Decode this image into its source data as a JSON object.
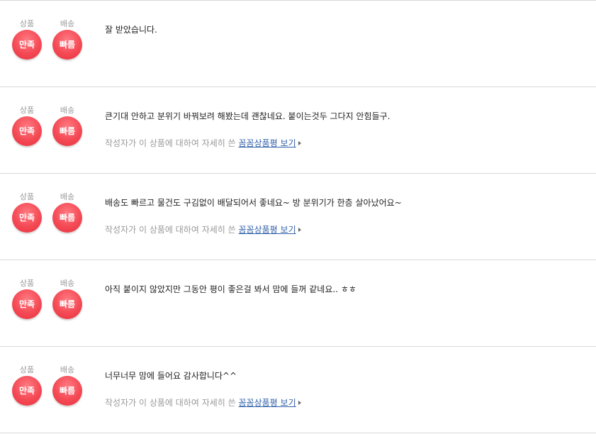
{
  "badges": {
    "product_label": "상품",
    "product_value": "만족",
    "delivery_label": "배송",
    "delivery_value": "빠름"
  },
  "detail_prefix": "작성자가 이 상품에 대하여 자세히 쓴",
  "detail_link": "꼼꼼상품평 보기",
  "reviews": [
    {
      "text": "잘 받았습니다."
    },
    {
      "text": "큰기대 안하고 분위기 바꿔보려 해봤는데 괜찮네요. 붙이는것두 그다지 안힘들구."
    },
    {
      "text": "배송도 빠르고 물건도 구김없이 배달되어서 좋네요~ 방 분위기가 한층 살아났어요~"
    },
    {
      "text": "아직 붙이지 않았지만 그동안 평이 좋은걸 봐서 맘에 들꺼 같네요.. ㅎㅎ"
    },
    {
      "text": "너무너무 맘에 들어요 감사합니다^^"
    }
  ]
}
